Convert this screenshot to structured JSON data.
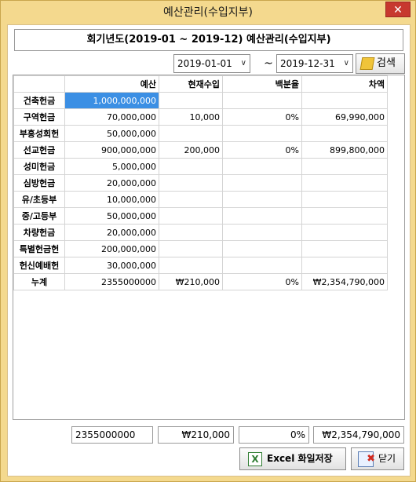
{
  "window": {
    "title": "예산관리(수입지부)",
    "close_symbol": "✕"
  },
  "heading": "회기년도(2019-01 ~ 2019-12) 예산관리(수입지부)",
  "filters": {
    "start_date": "2019-01-01",
    "end_date": "2019-12-31",
    "separator": "~",
    "search_label": "검색"
  },
  "grid": {
    "columns": [
      "",
      "예산",
      "현재수입",
      "백분율",
      "차액"
    ],
    "rows": [
      {
        "label": "건축헌금",
        "budget": "1,000,000,000",
        "income": "",
        "percent": "",
        "diff": ""
      },
      {
        "label": "구역헌금",
        "budget": "70,000,000",
        "income": "10,000",
        "percent": "0%",
        "diff": "69,990,000"
      },
      {
        "label": "부흥성회헌",
        "budget": "50,000,000",
        "income": "",
        "percent": "",
        "diff": ""
      },
      {
        "label": "선교헌금",
        "budget": "900,000,000",
        "income": "200,000",
        "percent": "0%",
        "diff": "899,800,000"
      },
      {
        "label": "성미헌금",
        "budget": "5,000,000",
        "income": "",
        "percent": "",
        "diff": ""
      },
      {
        "label": "심방헌금",
        "budget": "20,000,000",
        "income": "",
        "percent": "",
        "diff": ""
      },
      {
        "label": "유/초등부",
        "budget": "10,000,000",
        "income": "",
        "percent": "",
        "diff": ""
      },
      {
        "label": "중/고등부",
        "budget": "50,000,000",
        "income": "",
        "percent": "",
        "diff": ""
      },
      {
        "label": "차량헌금",
        "budget": "20,000,000",
        "income": "",
        "percent": "",
        "diff": ""
      },
      {
        "label": "특별헌금헌",
        "budget": "200,000,000",
        "income": "",
        "percent": "",
        "diff": ""
      },
      {
        "label": "헌신예배헌",
        "budget": "30,000,000",
        "income": "",
        "percent": "",
        "diff": ""
      },
      {
        "label": "누계",
        "budget": "2355000000",
        "income": "₩210,000",
        "percent": "0%",
        "diff": "₩2,354,790,000"
      }
    ]
  },
  "summary": {
    "budget_total": "2355000000",
    "income_total": "₩210,000",
    "percent_total": "0%",
    "diff_total": "₩2,354,790,000"
  },
  "buttons": {
    "excel_label": "Excel 화일저장",
    "close_label": "닫기"
  },
  "colors": {
    "selection": "#3b8fe4",
    "frame": "#f4d98e",
    "close": "#c7382f"
  }
}
